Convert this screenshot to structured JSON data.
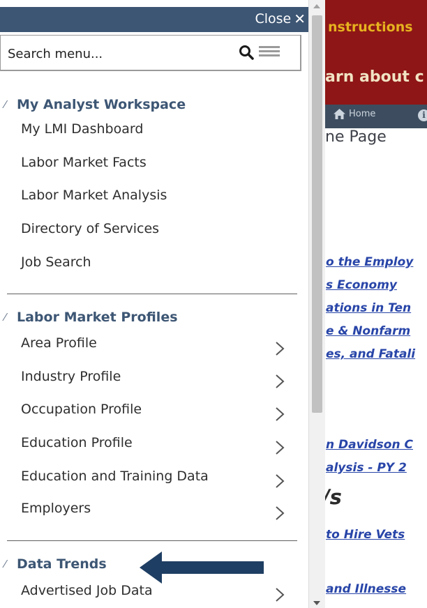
{
  "background": {
    "banner_top_text": "nstructions",
    "banner_bottom_text": "arn about c",
    "nav_home": "Home",
    "nav_info_icon": "info-icon",
    "page_title": "ne Page",
    "links": [
      "o the Employ",
      "s Economy",
      "ations in Ten",
      "e & Nonfarm",
      "es, and Fatali",
      "n Davidson C",
      "alysis - PY 2",
      "to Hire Vets",
      "and Illnesse"
    ],
    "heading": "/s",
    "colors": {
      "banner": "#8e1616",
      "instructions": "#e6b21f",
      "navbar": "#3d4d5f",
      "link": "#2845a8"
    }
  },
  "menu": {
    "close_label": "Close",
    "close_icon": "close-icon",
    "search": {
      "placeholder": "Search menu...",
      "value": ""
    },
    "sections": [
      {
        "title": "My Analyst Workspace",
        "items": [
          {
            "label": "My LMI Dashboard",
            "has_submenu": false
          },
          {
            "label": "Labor Market Facts",
            "has_submenu": false
          },
          {
            "label": "Labor Market Analysis",
            "has_submenu": false
          },
          {
            "label": "Directory of Services",
            "has_submenu": false
          },
          {
            "label": "Job Search",
            "has_submenu": false
          }
        ]
      },
      {
        "title": "Labor Market Profiles",
        "items": [
          {
            "label": "Area Profile",
            "has_submenu": true
          },
          {
            "label": "Industry Profile",
            "has_submenu": true
          },
          {
            "label": "Occupation Profile",
            "has_submenu": true
          },
          {
            "label": "Education Profile",
            "has_submenu": true
          },
          {
            "label": "Education and Training Data",
            "has_submenu": true
          },
          {
            "label": "Employers",
            "has_submenu": true
          }
        ]
      },
      {
        "title": "Data Trends",
        "items": [
          {
            "label": "Advertised Job Data",
            "has_submenu": true
          }
        ]
      }
    ],
    "colors": {
      "header": "#3d5674",
      "section_title": "#3d5674",
      "annotation_arrow": "#1f3e63"
    }
  }
}
